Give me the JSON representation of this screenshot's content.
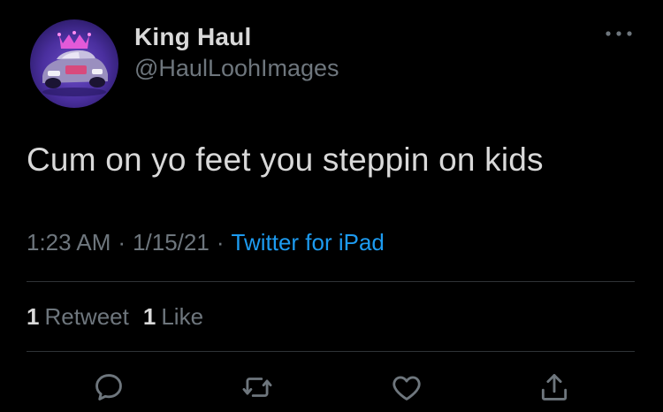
{
  "author": {
    "display_name": "King Haul",
    "handle": "@HaulLoohImages",
    "avatar_icon": "race-car-with-crown-avatar"
  },
  "tweet": {
    "text": "Cum on yo feet you steppin on kids"
  },
  "meta": {
    "time": "1:23 AM",
    "separator": "·",
    "date": "1/15/21",
    "source": "Twitter for iPad"
  },
  "stats": {
    "retweets_count": "1",
    "retweets_label": "Retweet",
    "likes_count": "1",
    "likes_label": "Like"
  },
  "actions": [
    "reply-icon",
    "retweet-icon",
    "like-icon",
    "share-icon"
  ],
  "colors": {
    "background": "#000000",
    "text": "#d9d9d9",
    "muted": "#6e767d",
    "link": "#1d9bf0",
    "divider": "#2f3336"
  }
}
